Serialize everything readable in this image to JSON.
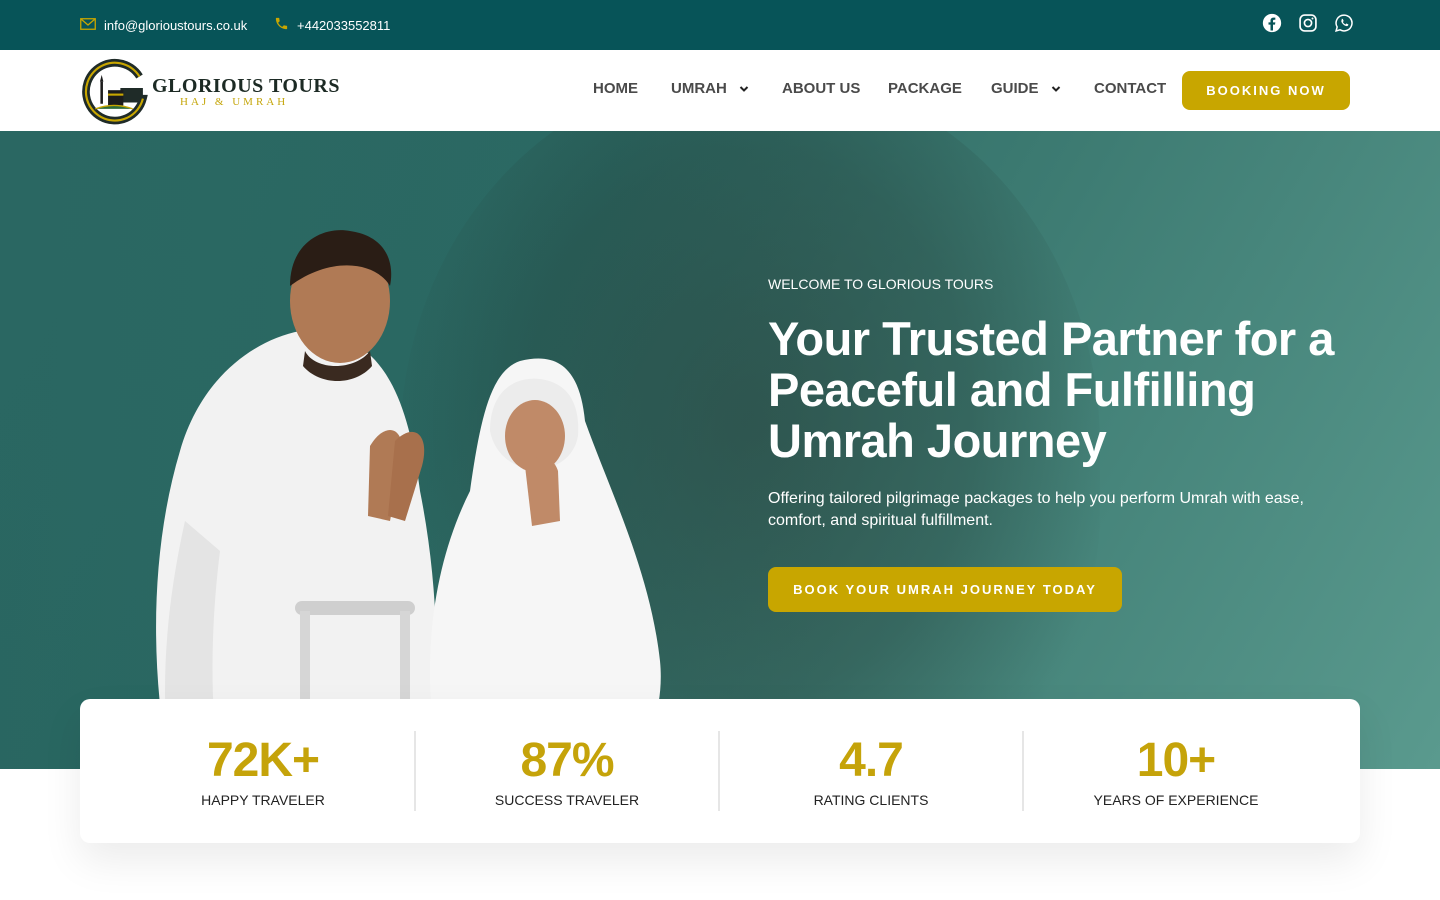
{
  "topbar": {
    "email": "info@glorioustours.co.uk",
    "phone": "+442033552811",
    "social_icons": [
      "facebook-icon",
      "instagram-icon",
      "whatsapp-icon"
    ]
  },
  "brand": {
    "title": "GLORIOUS TOURS",
    "subtitle": "HAJ & UMRAH",
    "colors": {
      "teal": "#075458",
      "gold": "#c8a600"
    }
  },
  "nav": {
    "items": [
      {
        "label": "HOME"
      },
      {
        "label": "UMRAH"
      },
      {
        "label": "ABOUT US"
      },
      {
        "label": "PACKAGE"
      },
      {
        "label": "GUIDE"
      },
      {
        "label": "CONTACT"
      }
    ],
    "cta": "BOOKING NOW"
  },
  "hero": {
    "eyebrow": "WELCOME TO GLORIOUS TOURS",
    "headline": "Your Trusted Partner for a Peaceful and Fulfilling Umrah Journey",
    "subtext": "Offering tailored pilgrimage packages to help you perform Umrah with ease, comfort, and spiritual fulfillment.",
    "cta": "BOOK YOUR UMRAH JOURNEY TODAY"
  },
  "stats": [
    {
      "value": "72K+",
      "label": "HAPPY TRAVELER"
    },
    {
      "value": "87%",
      "label": "SUCCESS TRAVELER"
    },
    {
      "value": "4.7",
      "label": "RATING CLIENTS"
    },
    {
      "value": "10+",
      "label": "YEARS OF EXPERIENCE"
    }
  ]
}
